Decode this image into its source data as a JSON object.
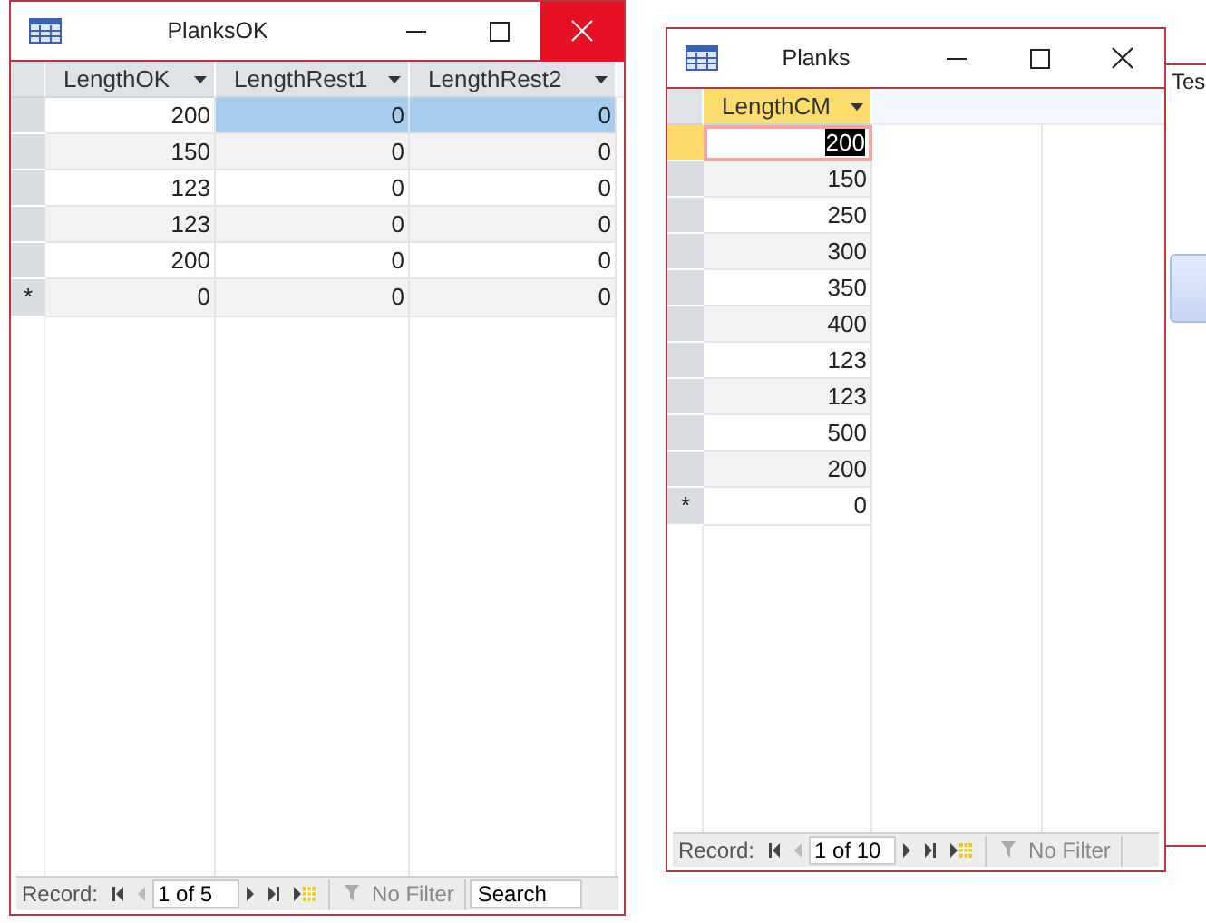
{
  "windows": [
    {
      "title": "PlanksOK",
      "close_highlighted": true,
      "search": "Search",
      "columns": [
        {
          "label": "LengthOK",
          "selected": false
        },
        {
          "label": "LengthRest1",
          "selected": false
        },
        {
          "label": "LengthRest2",
          "selected": false
        }
      ],
      "rows": [
        {
          "current": false,
          "cells": [
            {
              "text": "200",
              "selected": false,
              "editing": false
            },
            {
              "text": "0",
              "selected": true,
              "editing": false
            },
            {
              "text": "0",
              "selected": true,
              "editing": false
            }
          ]
        },
        {
          "current": false,
          "cells": [
            {
              "text": "150",
              "selected": false,
              "editing": false
            },
            {
              "text": "0",
              "selected": false,
              "editing": false
            },
            {
              "text": "0",
              "selected": false,
              "editing": false
            }
          ]
        },
        {
          "current": false,
          "cells": [
            {
              "text": "123",
              "selected": false,
              "editing": false
            },
            {
              "text": "0",
              "selected": false,
              "editing": false
            },
            {
              "text": "0",
              "selected": false,
              "editing": false
            }
          ]
        },
        {
          "current": false,
          "cells": [
            {
              "text": "123",
              "selected": false,
              "editing": false
            },
            {
              "text": "0",
              "selected": false,
              "editing": false
            },
            {
              "text": "0",
              "selected": false,
              "editing": false
            }
          ]
        },
        {
          "current": false,
          "cells": [
            {
              "text": "200",
              "selected": false,
              "editing": false
            },
            {
              "text": "0",
              "selected": false,
              "editing": false
            },
            {
              "text": "0",
              "selected": false,
              "editing": false
            }
          ]
        }
      ],
      "new_row": {
        "marker": "*",
        "cells": [
          "0",
          "0",
          "0"
        ]
      },
      "record_nav": {
        "label": "Record:",
        "position": "1 of 5",
        "filter": "No Filter"
      }
    },
    {
      "title": "Planks",
      "close_highlighted": false,
      "columns": [
        {
          "label": "LengthCM",
          "selected": true
        }
      ],
      "rows": [
        {
          "current": true,
          "cells": [
            {
              "text": "200",
              "selected": false,
              "editing": true
            }
          ]
        },
        {
          "current": false,
          "cells": [
            {
              "text": "150",
              "selected": false,
              "editing": false
            }
          ]
        },
        {
          "current": false,
          "cells": [
            {
              "text": "250",
              "selected": false,
              "editing": false
            }
          ]
        },
        {
          "current": false,
          "cells": [
            {
              "text": "300",
              "selected": false,
              "editing": false
            }
          ]
        },
        {
          "current": false,
          "cells": [
            {
              "text": "350",
              "selected": false,
              "editing": false
            }
          ]
        },
        {
          "current": false,
          "cells": [
            {
              "text": "400",
              "selected": false,
              "editing": false
            }
          ]
        },
        {
          "current": false,
          "cells": [
            {
              "text": "123",
              "selected": false,
              "editing": false
            }
          ]
        },
        {
          "current": false,
          "cells": [
            {
              "text": "123",
              "selected": false,
              "editing": false
            }
          ]
        },
        {
          "current": false,
          "cells": [
            {
              "text": "500",
              "selected": false,
              "editing": false
            }
          ]
        },
        {
          "current": false,
          "cells": [
            {
              "text": "200",
              "selected": false,
              "editing": false
            }
          ]
        }
      ],
      "new_row": {
        "marker": "*",
        "cells": [
          "0"
        ]
      },
      "record_nav": {
        "label": "Record:",
        "position": "1 of 10",
        "filter": "No Filter"
      }
    }
  ],
  "background_window": {
    "title": "Tes"
  }
}
